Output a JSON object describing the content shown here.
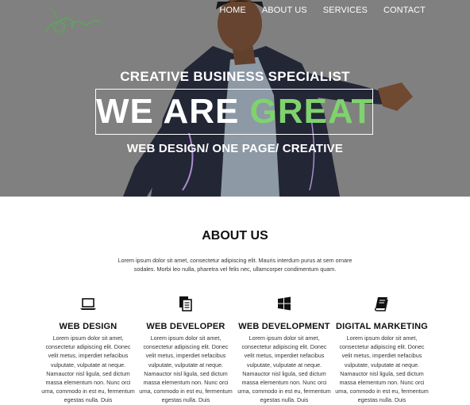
{
  "nav": {
    "items": [
      "HOME",
      "ABOUT US",
      "SERVICES",
      "CONTACT"
    ]
  },
  "hero": {
    "tagline": "CREATIVE BUSINESS SPECIALIST",
    "headline_white": "WE ARE",
    "headline_accent": "GREAT",
    "subline": "WEB DESIGN/ ONE PAGE/ CREATIVE",
    "accent_color": "#7fd36e"
  },
  "about": {
    "title": "ABOUT US",
    "text": "Lorem ipsum dolor sit amet, consectetur adipiscing elit. Mauris interdum purus at sem ornare sodales. Morbi leo nulla, pharetra vel felis nec, ullamcorper condimentum quam."
  },
  "services": [
    {
      "icon": "laptop-icon",
      "title": "WEB DESIGN",
      "text": "Lorem ipsum dolor sit amet, consectetur adipiscing elit. Donec velit metus, imperdiet nefacibus vulputate, vulputate at neque. Namauctor nisl ligula, sed dictum massa elementum non. Nunc orci urna, commodo in est eu, fermentum egestas nulla. Duis"
    },
    {
      "icon": "documents-icon",
      "title": "WEB DEVELOPER",
      "text": "Lorem ipsum dolor sit amet, consectetur adipiscing elit. Donec velit metus, imperdiet nefacibus vulputate, vulputate at neque. Namauctor nisl ligula, sed dictum massa elementum non. Nunc orci urna, commodo in est eu, fermentum egestas nulla. Duis"
    },
    {
      "icon": "windows-icon",
      "title": "WEB DEVELOPMENT",
      "text": "Lorem ipsum dolor sit amet, consectetur adipiscing elit. Donec velit metus, imperdiet nefacibus vulputate, vulputate at neque. Namauctor nisl ligula, sed dictum massa elementum non. Nunc orci urna, commodo in est eu, fermentum egestas nulla. Duis"
    },
    {
      "icon": "book-icon",
      "title": "DIGITAL MARKETING",
      "text": "Lorem ipsum dolor sit amet, consectetur adipiscing elit. Donec velit metus, imperdiet nefacibus vulputate, vulputate at neque. Namauctor nisl ligula, sed dictum massa elementum non. Nunc orci urna, commodo in est eu, fermentum egestas nulla. Duis"
    }
  ]
}
